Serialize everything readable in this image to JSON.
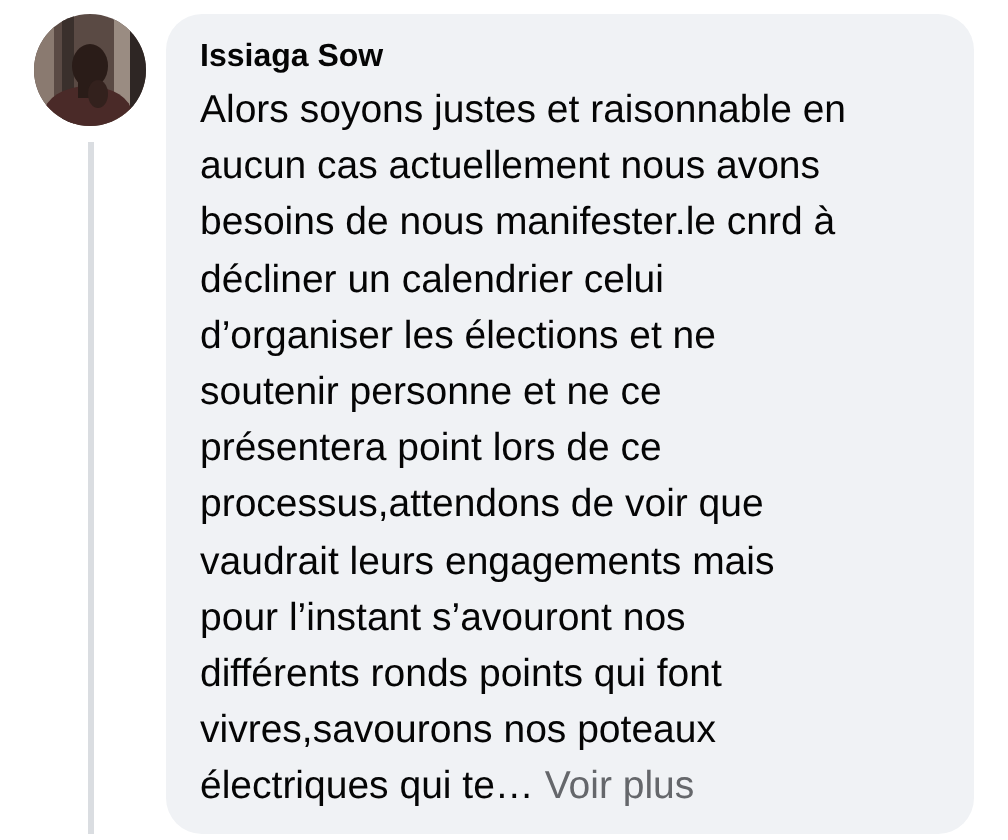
{
  "comment": {
    "author": "Issiaga Sow",
    "text": "Alors soyons justes et raisonnable en\naucun cas actuellement nous avons\nbesoins de nous manifester.le cnrd à\ndécliner un calendrier celui\nd’organiser les élections et ne\nsoutenir personne et ne ce\nprésentera point lors de ce\nprocessus,attendons de voir que\nvaudrait leurs engagements mais\npour l’instant s’avouront nos\ndifférents ronds points qui font\nvivres,savourons nos poteaux\nélectriques qui te…",
    "see_more": "Voir plus"
  }
}
